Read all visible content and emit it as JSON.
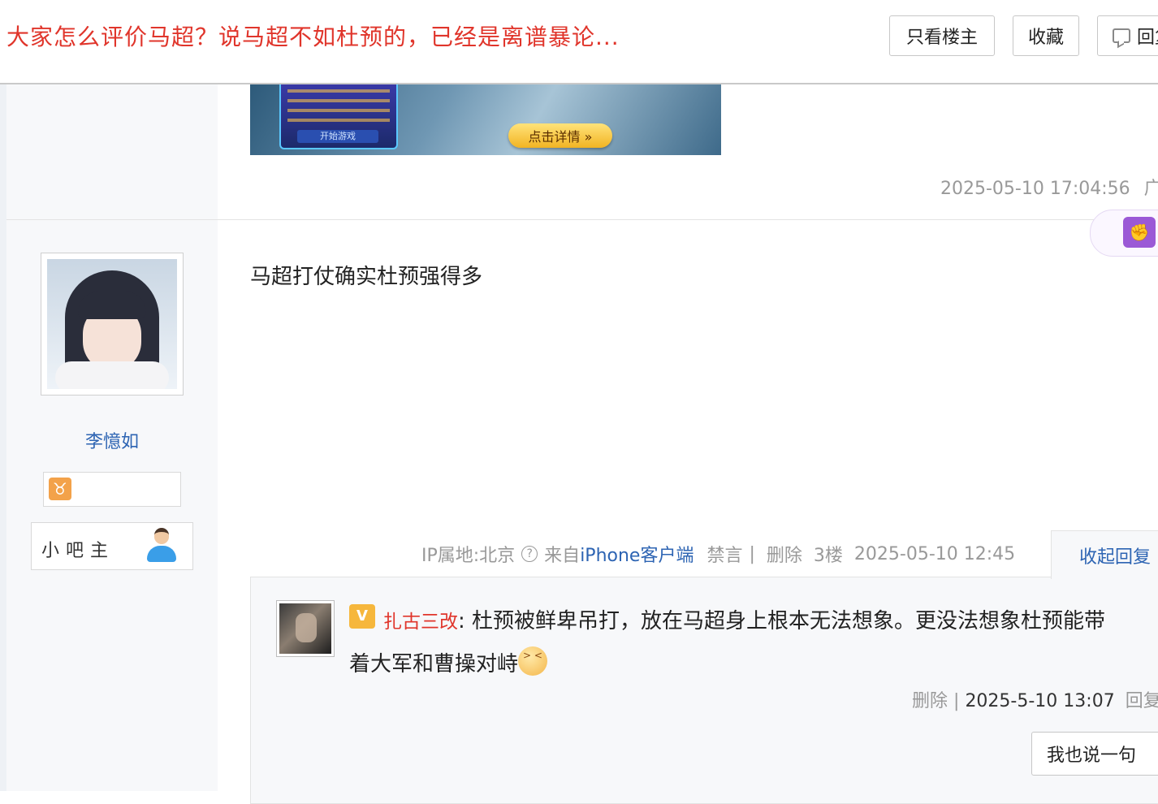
{
  "header": {
    "title": "大家怎么评价马超？说马超不如杜预的，已经是离谱暴论...",
    "only_op_label": "只看楼主",
    "favorite_label": "收藏",
    "reply_label": "回复"
  },
  "ad_post": {
    "cta_label": "点击详情 »",
    "start_label": "开始游戏",
    "timestamp": "2025-05-10 17:04:56",
    "ad_tag": "广告"
  },
  "side_badge": {
    "icon": "fist-icon",
    "color": "#9b59d6"
  },
  "post": {
    "author": {
      "name": "李憶如",
      "badge_icon": "taurus-icon",
      "role": "小吧主"
    },
    "content": "马超打仗确实杜预强得多",
    "meta": {
      "ip": "IP属地:北京",
      "from_prefix": "来自",
      "client": "iPhone客户端",
      "ban": "禁言",
      "sep": "|",
      "delete": "删除",
      "floor": "3楼",
      "time": "2025-05-10 12:45"
    },
    "collapse_label": "收起回复"
  },
  "reply": {
    "user": "扎古三改",
    "line1": ": 杜预被鲜卑吊打，放在马超身上根本无法想象。更没法想象杜预能带",
    "line2": "着大军和曹操对峙",
    "delete": "删除",
    "sep": "|",
    "time": "2025-5-10 13:07",
    "reply": "回复",
    "say_label": "我也说一句"
  },
  "colors": {
    "title_red": "#e0352b",
    "link_blue": "#2d64b3",
    "meta_gray": "#999999"
  }
}
